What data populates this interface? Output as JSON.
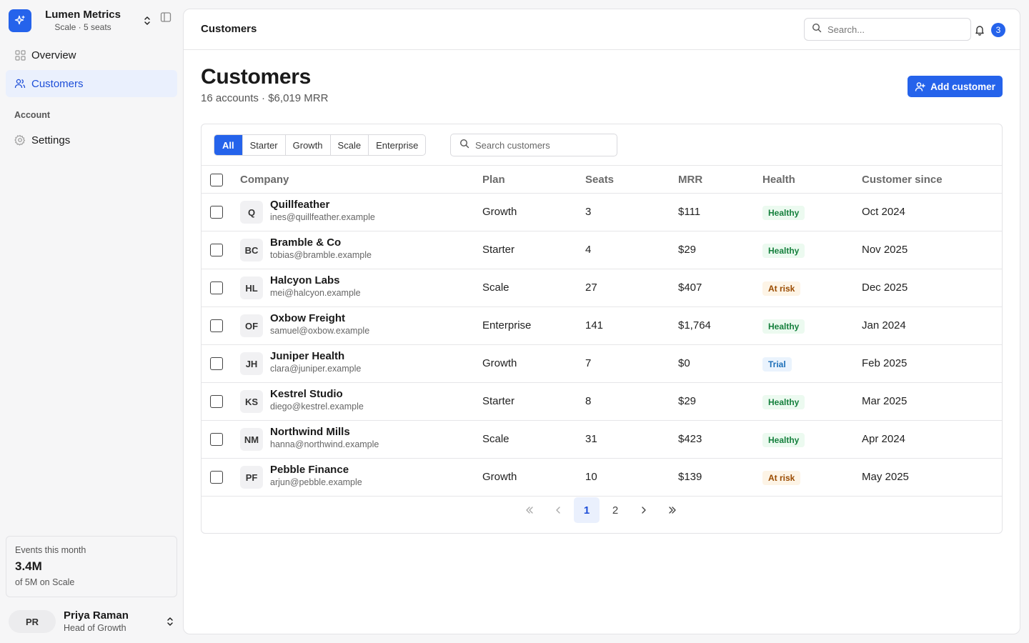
{
  "colors": {
    "accent": "#2563eb",
    "healthy": "#15803d",
    "at_risk": "#9a4b00",
    "trial": "#1d6fb8"
  },
  "brand": {
    "name": "Lumen Metrics",
    "sub": "Scale · 5 seats",
    "logo_icon": "sparkles-icon"
  },
  "nav": {
    "items": [
      {
        "label": "Overview",
        "icon": "grid-icon"
      },
      {
        "label": "Customers",
        "icon": "users-icon"
      }
    ],
    "section_label": "Account",
    "settings": {
      "label": "Settings",
      "icon": "gear-icon"
    }
  },
  "usage": {
    "label": "Events this month",
    "value": "3.4M",
    "sub": "of 5M on Scale"
  },
  "user": {
    "initials": "PR",
    "name": "Priya Raman",
    "role": "Head of Growth"
  },
  "topbar": {
    "title": "Customers",
    "search_placeholder": "Search...",
    "notifications": "3"
  },
  "page": {
    "title": "Customers",
    "subtitle": "16 accounts · $6,019 MRR",
    "add_label": "Add customer"
  },
  "filters": [
    "All",
    "Starter",
    "Growth",
    "Scale",
    "Enterprise"
  ],
  "table_search_placeholder": "Search customers",
  "columns": [
    "Company",
    "Plan",
    "Seats",
    "MRR",
    "Health",
    "Customer since"
  ],
  "rows": [
    {
      "initials": "Q",
      "company": "Quillfeather",
      "email": "ines@quillfeather.example",
      "plan": "Growth",
      "seats": "3",
      "mrr": "$111",
      "health": "Healthy",
      "since": "Oct 2024"
    },
    {
      "initials": "BC",
      "company": "Bramble & Co",
      "email": "tobias@bramble.example",
      "plan": "Starter",
      "seats": "4",
      "mrr": "$29",
      "health": "Healthy",
      "since": "Nov 2025"
    },
    {
      "initials": "HL",
      "company": "Halcyon Labs",
      "email": "mei@halcyon.example",
      "plan": "Scale",
      "seats": "27",
      "mrr": "$407",
      "health": "At risk",
      "since": "Dec 2025"
    },
    {
      "initials": "OF",
      "company": "Oxbow Freight",
      "email": "samuel@oxbow.example",
      "plan": "Enterprise",
      "seats": "141",
      "mrr": "$1,764",
      "health": "Healthy",
      "since": "Jan 2024"
    },
    {
      "initials": "JH",
      "company": "Juniper Health",
      "email": "clara@juniper.example",
      "plan": "Growth",
      "seats": "7",
      "mrr": "$0",
      "health": "Trial",
      "since": "Feb 2025"
    },
    {
      "initials": "KS",
      "company": "Kestrel Studio",
      "email": "diego@kestrel.example",
      "plan": "Starter",
      "seats": "8",
      "mrr": "$29",
      "health": "Healthy",
      "since": "Mar 2025"
    },
    {
      "initials": "NM",
      "company": "Northwind Mills",
      "email": "hanna@northwind.example",
      "plan": "Scale",
      "seats": "31",
      "mrr": "$423",
      "health": "Healthy",
      "since": "Apr 2024"
    },
    {
      "initials": "PF",
      "company": "Pebble Finance",
      "email": "arjun@pebble.example",
      "plan": "Growth",
      "seats": "10",
      "mrr": "$139",
      "health": "At risk",
      "since": "May 2025"
    }
  ],
  "pagination": {
    "pages": [
      "1",
      "2"
    ],
    "current": "1"
  }
}
